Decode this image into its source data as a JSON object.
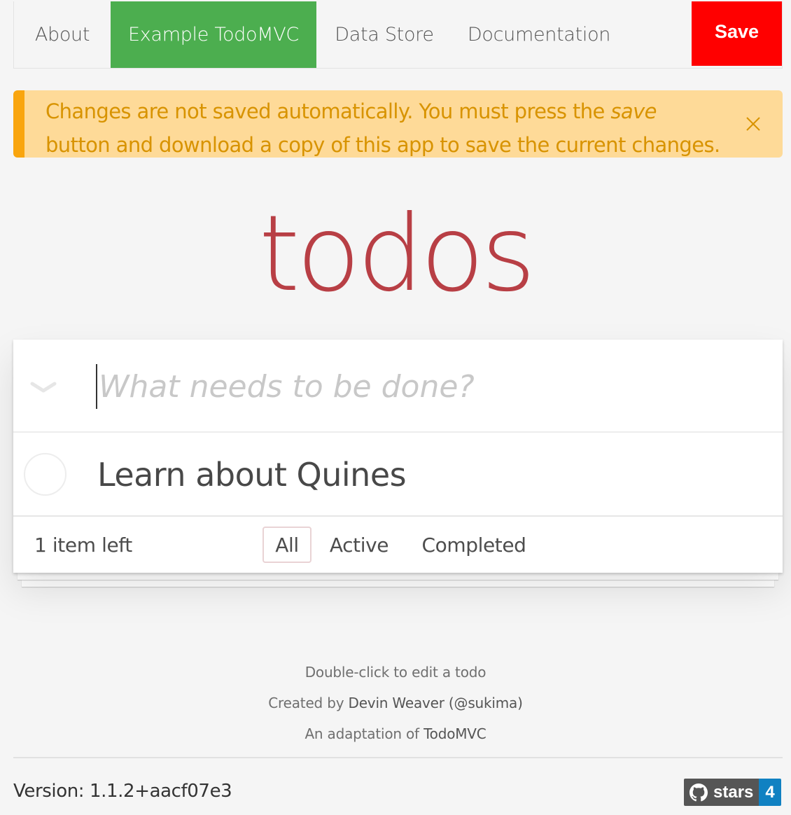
{
  "nav": {
    "tabs": [
      {
        "label": "About"
      },
      {
        "label": "Example TodoMVC"
      },
      {
        "label": "Data Store"
      },
      {
        "label": "Documentation"
      }
    ],
    "active_tab": "Example TodoMVC",
    "save_label": "Save"
  },
  "alert": {
    "text_before": "Changes are not saved automatically. You must press the ",
    "emphasis": "save",
    "text_after": " button and download a copy of this app to save the current changes.",
    "close_icon": "close-icon"
  },
  "app": {
    "title": "todos",
    "new_todo_placeholder": "What needs to be done?",
    "new_todo_value": "",
    "todos": [
      {
        "label": "Learn about Quines",
        "completed": false
      }
    ],
    "count_text": "1 item left",
    "filters": [
      {
        "label": "All",
        "selected": true
      },
      {
        "label": "Active",
        "selected": false
      },
      {
        "label": "Completed",
        "selected": false
      }
    ]
  },
  "info": {
    "line1": "Double-click to edit a todo",
    "line2_prefix": "Created by ",
    "line2_link": "Devin Weaver (@sukima)",
    "line3_prefix": "An adaptation of ",
    "line3_link": "TodoMVC"
  },
  "footer": {
    "version": "Version: 1.1.2+aacf07e3",
    "badge_label": "stars",
    "badge_count": "4"
  },
  "colors": {
    "active_tab": "#4cae4f",
    "save": "#ff0000",
    "alert_bg": "#feda98",
    "alert_border": "#f9a50e",
    "alert_text": "#d89300",
    "title": "#b83f45",
    "badge_count_bg": "#1081c2"
  }
}
